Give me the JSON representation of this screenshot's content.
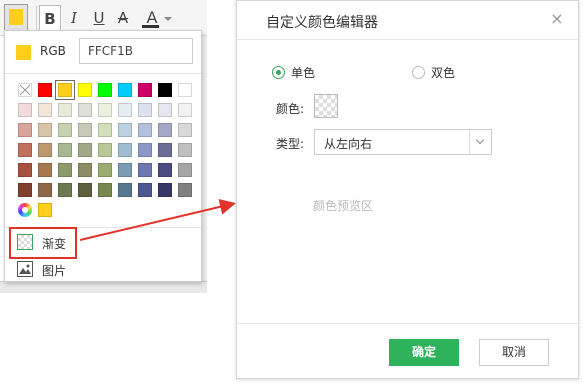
{
  "toolbar": {
    "fill_color": "#ffcf1b",
    "bold": "B",
    "italic": "I",
    "underline": "U",
    "strike": "A",
    "font_color": "A"
  },
  "popup": {
    "current_color": "#ffcf1b",
    "rgb_label": "RGB",
    "rgb_value": "FFCF1B",
    "palette": [
      [
        "none",
        "#ff0000",
        "#ffcf1b",
        "#ffff00",
        "#00ff00",
        "#00ccff",
        "#cc0066",
        "#000000",
        "#ffffff"
      ],
      [
        "#f2dcdb",
        "#f2e6d6",
        "#e6ecd9",
        "#dde0d8",
        "#ebf1de",
        "#e6eef4",
        "#dde2ee",
        "#e6e6ee",
        "#f2f2f2"
      ],
      [
        "#d9a59a",
        "#d9c4a8",
        "#c7d2b2",
        "#c7c8b8",
        "#d2dfbd",
        "#bdd2e0",
        "#b4bfdd",
        "#a5a8c4",
        "#d9d9d9"
      ],
      [
        "#c0705c",
        "#c09870",
        "#a8b890",
        "#a0a888",
        "#b8c898",
        "#a0bcd0",
        "#8c98c8",
        "#6c6c98",
        "#bfbfbf"
      ],
      [
        "#a85040",
        "#a87850",
        "#8c9a6c",
        "#8c8c64",
        "#9cac70",
        "#7c9cb4",
        "#6c78b0",
        "#4c4c80",
        "#a6a6a6"
      ],
      [
        "#804030",
        "#906848",
        "#6c7850",
        "#606040",
        "#788850",
        "#587890",
        "#4c5890",
        "#383868",
        "#808080"
      ]
    ],
    "recent_color": "#ffcf1b",
    "gradient_label": "渐变",
    "image_label": "图片"
  },
  "dialog": {
    "title": "自定义颜色编辑器",
    "close": "×",
    "mode_single": "单色",
    "mode_dual": "双色",
    "color_label": "颜色:",
    "type_label": "类型:",
    "type_value": "从左向右",
    "preview_text": "颜色预览区",
    "ok": "确定",
    "cancel": "取消",
    "accent": "#2fb25c"
  },
  "annotation": {
    "highlight": "#e3322a"
  }
}
